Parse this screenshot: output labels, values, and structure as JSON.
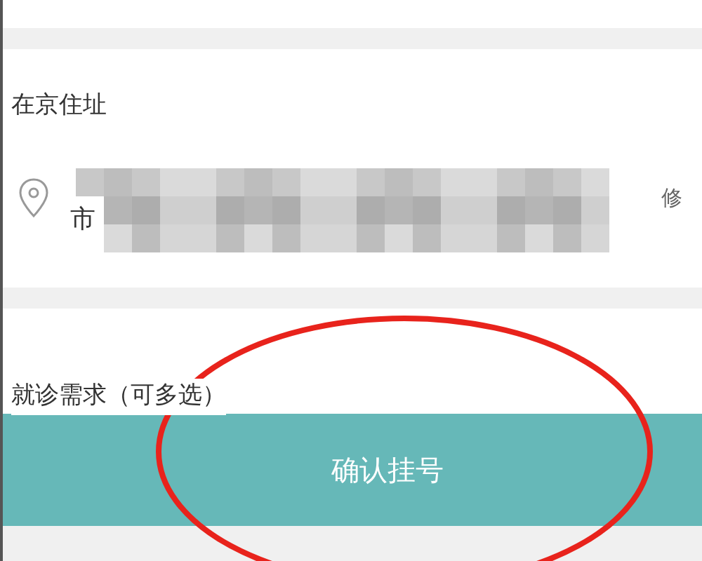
{
  "address_section": {
    "title": "在京住址",
    "address_line": "市",
    "edit_link": "修"
  },
  "needs_section": {
    "title": "就诊需求（可多选）"
  },
  "confirm_button": {
    "label": "确认挂号"
  }
}
